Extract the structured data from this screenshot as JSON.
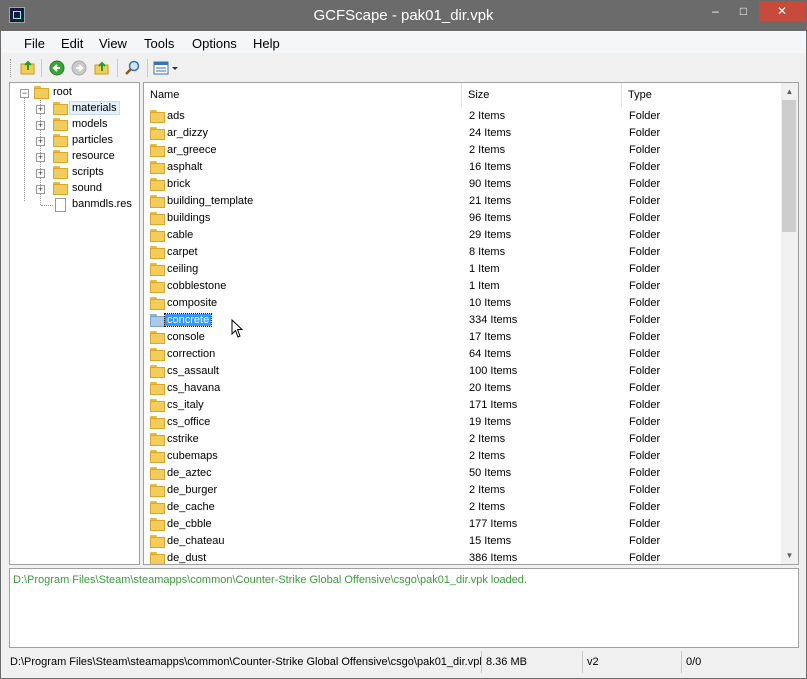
{
  "window": {
    "title": "GCFScape - pak01_dir.vpk"
  },
  "titlebar": {
    "minimize": "–",
    "maximize": "□",
    "close": "✕"
  },
  "menu": [
    "File",
    "Edit",
    "View",
    "Tools",
    "Options",
    "Help"
  ],
  "toolbar": {
    "icons": [
      "open-folder-icon",
      "back-icon",
      "forward-icon",
      "up-folder-icon",
      "search-icon",
      "view-icon",
      "dropdown-arrow-icon"
    ]
  },
  "tree": {
    "root": "root",
    "items": [
      {
        "label": "materials",
        "type": "folder",
        "selected": true
      },
      {
        "label": "models",
        "type": "folder"
      },
      {
        "label": "particles",
        "type": "folder"
      },
      {
        "label": "resource",
        "type": "folder"
      },
      {
        "label": "scripts",
        "type": "folder"
      },
      {
        "label": "sound",
        "type": "folder"
      },
      {
        "label": "banmdls.res",
        "type": "file"
      }
    ]
  },
  "list": {
    "columns": [
      "Name",
      "Size",
      "Type"
    ],
    "rows": [
      {
        "name": "ads",
        "size": "2 Items",
        "type": "Folder"
      },
      {
        "name": "ar_dizzy",
        "size": "24 Items",
        "type": "Folder"
      },
      {
        "name": "ar_greece",
        "size": "2 Items",
        "type": "Folder"
      },
      {
        "name": "asphalt",
        "size": "16 Items",
        "type": "Folder"
      },
      {
        "name": "brick",
        "size": "90 Items",
        "type": "Folder"
      },
      {
        "name": "building_template",
        "size": "21 Items",
        "type": "Folder"
      },
      {
        "name": "buildings",
        "size": "96 Items",
        "type": "Folder"
      },
      {
        "name": "cable",
        "size": "29 Items",
        "type": "Folder"
      },
      {
        "name": "carpet",
        "size": "8 Items",
        "type": "Folder"
      },
      {
        "name": "ceiling",
        "size": "1 Item",
        "type": "Folder"
      },
      {
        "name": "cobblestone",
        "size": "1 Item",
        "type": "Folder"
      },
      {
        "name": "composite",
        "size": "10 Items",
        "type": "Folder"
      },
      {
        "name": "concrete",
        "size": "334 Items",
        "type": "Folder",
        "selected": true
      },
      {
        "name": "console",
        "size": "17 Items",
        "type": "Folder"
      },
      {
        "name": "correction",
        "size": "64 Items",
        "type": "Folder"
      },
      {
        "name": "cs_assault",
        "size": "100 Items",
        "type": "Folder"
      },
      {
        "name": "cs_havana",
        "size": "20 Items",
        "type": "Folder"
      },
      {
        "name": "cs_italy",
        "size": "171 Items",
        "type": "Folder"
      },
      {
        "name": "cs_office",
        "size": "19 Items",
        "type": "Folder"
      },
      {
        "name": "cstrike",
        "size": "2 Items",
        "type": "Folder"
      },
      {
        "name": "cubemaps",
        "size": "2 Items",
        "type": "Folder"
      },
      {
        "name": "de_aztec",
        "size": "50 Items",
        "type": "Folder"
      },
      {
        "name": "de_burger",
        "size": "2 Items",
        "type": "Folder"
      },
      {
        "name": "de_cache",
        "size": "2 Items",
        "type": "Folder"
      },
      {
        "name": "de_cbble",
        "size": "177 Items",
        "type": "Folder"
      },
      {
        "name": "de_chateau",
        "size": "15 Items",
        "type": "Folder"
      },
      {
        "name": "de_dust",
        "size": "386 Items",
        "type": "Folder"
      }
    ]
  },
  "log": {
    "lines": [
      "D:\\Program Files\\Steam\\steamapps\\common\\Counter-Strike Global Offensive\\csgo\\pak01_dir.vpk loaded."
    ],
    "color": "#3a9a3a"
  },
  "statusbar": {
    "path": "D:\\Program Files\\Steam\\steamapps\\common\\Counter-Strike Global Offensive\\csgo\\pak01_dir.vpk",
    "size": "8.36 MB",
    "version": "v2",
    "count": "0/0"
  },
  "colors": {
    "titlebar": "#6b6b6b",
    "close": "#c74a3a",
    "selection": "#3399ff"
  }
}
